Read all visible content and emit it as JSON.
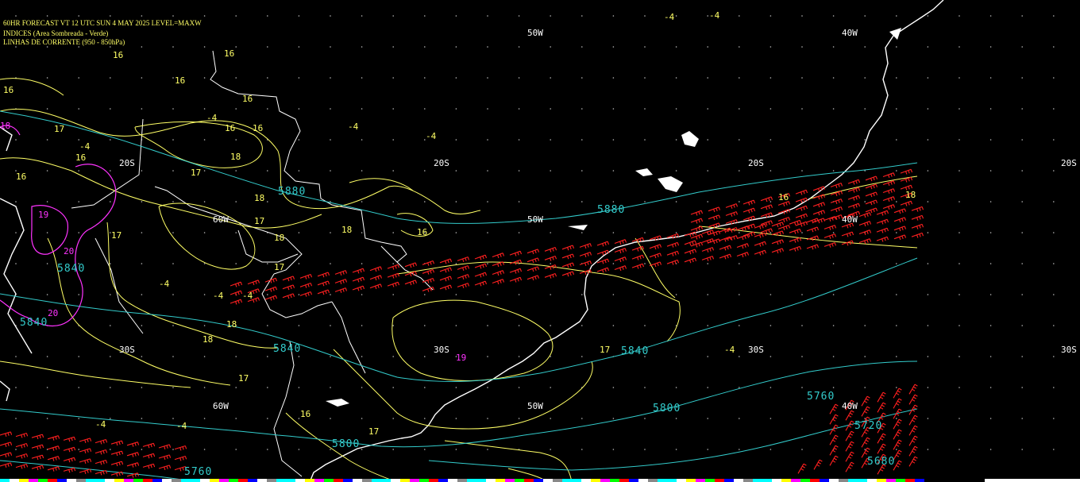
{
  "header": {
    "line1": "60HR FORECAST   VT 12 UTC SUN  4 MAY 2025    LEVEL=MAXW",
    "line2": "INDICES (Area Sombreada - Verde)",
    "line3": "LINHAS DE CORRENTE (950 - 850hPa)"
  },
  "colors": {
    "background": "#000000",
    "coastline": "#ffffff",
    "index_contours": "#ffff66",
    "height_contours": "#33cccc",
    "wind_barbs": "#ff2020",
    "magenta_contours": "#ff33ff",
    "grid_labels": "#ffffff"
  },
  "grid_labels": {
    "lon_50w_top": "50W",
    "lon_40w_top": "40W",
    "lon_60w_mid": "60W",
    "lon_50w_mid": "50W",
    "lon_40w_mid": "40W",
    "lon_60w_low": "60W",
    "lon_50w_low": "50W",
    "lon_40w_low": "40W",
    "lat_20s_a": "20S",
    "lat_20s_b": "20S",
    "lat_20s_c": "20S",
    "lat_20s_d": "20S",
    "lat_30s_a": "30S",
    "lat_30s_b": "30S",
    "lat_30s_c": "30S",
    "lat_30s_d": "30S"
  },
  "height_labels": {
    "h5880_a": "5880",
    "h5880_b": "5880",
    "h5840_a": "5840",
    "h5840_b": "5840",
    "h5840_c": "5840",
    "h5840_d": "5840",
    "h5800_a": "5800",
    "h5800_b": "5800",
    "h5760_a": "5760",
    "h5760_b": "5760",
    "h5720": "5720",
    "h5680": "5680"
  },
  "index_labels": {
    "t16_a": "16",
    "t16_b": "16",
    "t16_c": "16",
    "t16_d": "16",
    "t16_e": "16",
    "t16_f": "16",
    "t16_g": "16",
    "t16_h": "16",
    "t16_i": "16",
    "t16_j": "16",
    "t16_k": "16",
    "t16_l": "16",
    "t17_a": "17",
    "t17_b": "17",
    "t17_c": "17",
    "t17_d": "17",
    "t17_e": "17",
    "t17_f": "17",
    "t17_g": "17",
    "t17_h": "17",
    "t18_a": "18",
    "t18_b": "18",
    "t18_c": "18",
    "t18_d": "18",
    "t18_e": "18",
    "t18_f": "18",
    "t18_g": "18",
    "m4_a": "-4",
    "m4_b": "-4",
    "m4_c": "-4",
    "m4_d": "-4",
    "m4_e": "-4",
    "m4_f": "-4",
    "m4_g": "-4",
    "m4_h": "-4",
    "m4_i": "-4",
    "m4_j": "-4",
    "m4_k": "-4",
    "m4_l": "-4"
  },
  "magenta_labels": {
    "m19_a": "19",
    "m19_b": "19",
    "m20_a": "20",
    "m20_b": "20",
    "m18": "18"
  }
}
